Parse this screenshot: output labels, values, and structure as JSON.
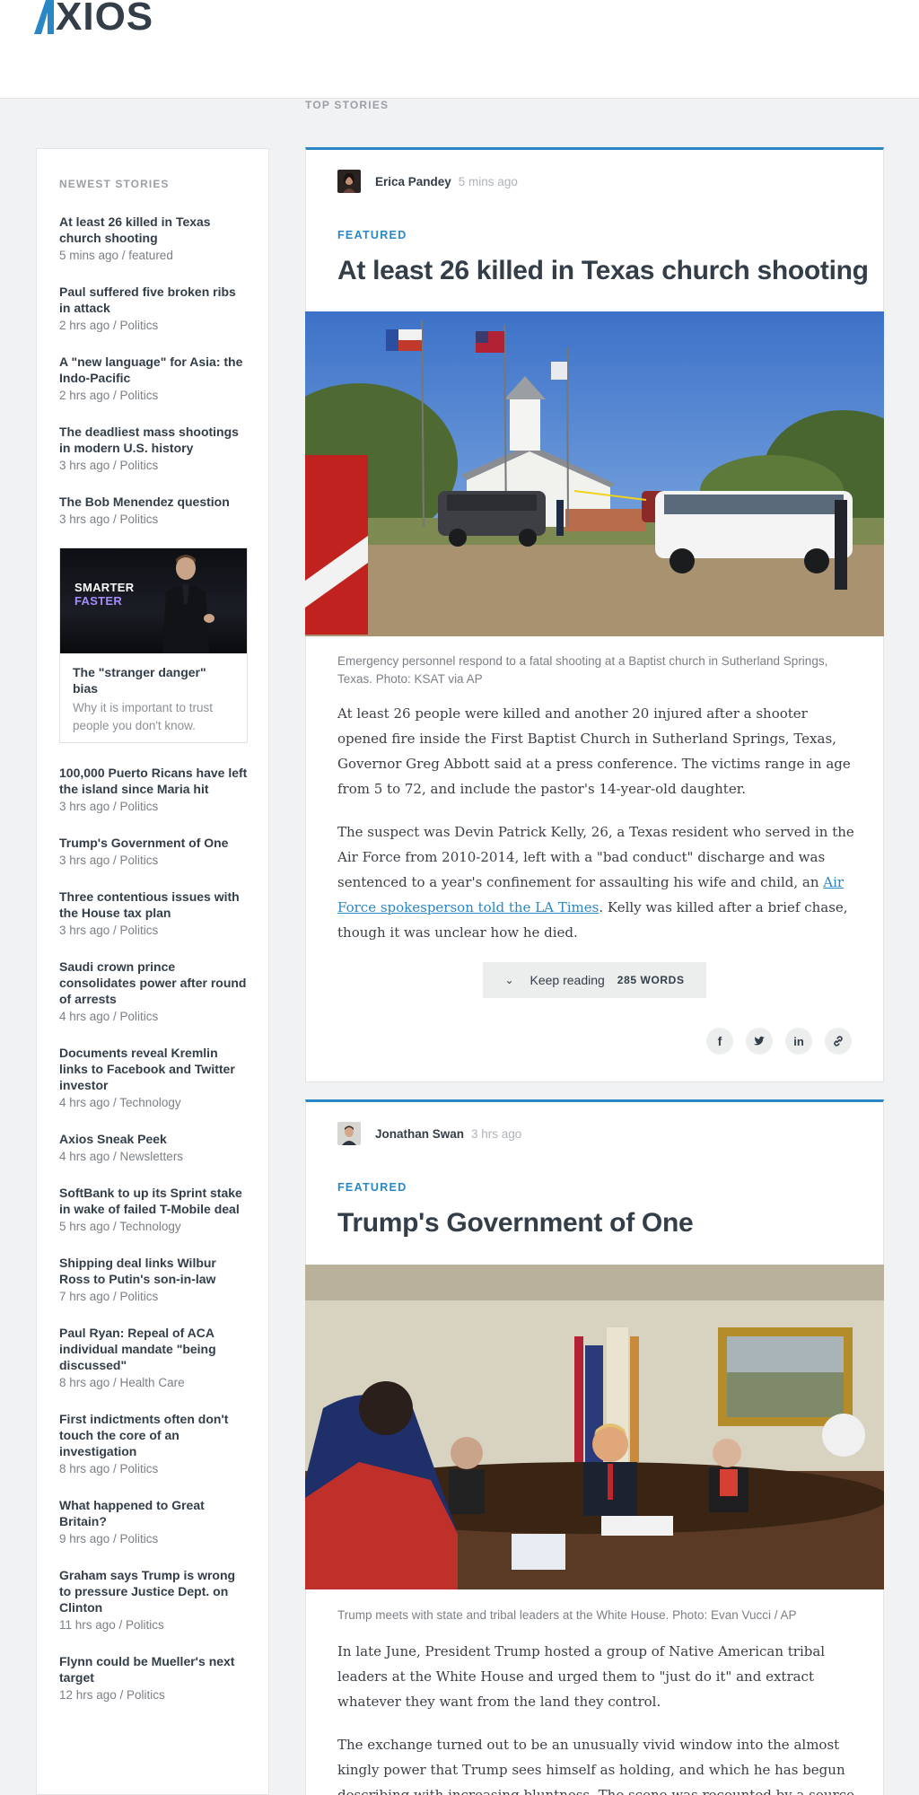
{
  "brand": {
    "logo_text": "XIOS",
    "accent": "#2a87c6"
  },
  "top_stories_label": "TOP STORIES",
  "sidebar": {
    "title": "NEWEST STORIES",
    "items_a": [
      {
        "title": "At least 26 killed in Texas church shooting",
        "meta": "5 mins ago / featured"
      },
      {
        "title": "Paul suffered five broken ribs in attack",
        "meta": "2 hrs ago / Politics"
      },
      {
        "title": "A \"new language\" for Asia: the Indo-Pacific",
        "meta": "2 hrs ago / Politics"
      },
      {
        "title": "The deadliest mass shootings in modern U.S. history",
        "meta": "3 hrs ago / Politics"
      },
      {
        "title": "The Bob Menendez question",
        "meta": "3 hrs ago / Politics"
      }
    ],
    "promo": {
      "heading1": "SMARTER",
      "heading2": "FASTER",
      "title": "The \"stranger danger\" bias",
      "desc": "Why it is important to trust people you don't know."
    },
    "items_b": [
      {
        "title": "100,000 Puerto Ricans have left the island since Maria hit",
        "meta": "3 hrs ago / Politics"
      },
      {
        "title": "Trump's Government of One",
        "meta": "3 hrs ago / Politics"
      },
      {
        "title": "Three contentious issues with the House tax plan",
        "meta": "3 hrs ago / Politics"
      },
      {
        "title": "Saudi crown prince consolidates power after round of arrests",
        "meta": "4 hrs ago / Politics"
      },
      {
        "title": "Documents reveal Kremlin links to Facebook and Twitter investor",
        "meta": "4 hrs ago / Technology"
      },
      {
        "title": "Axios Sneak Peek",
        "meta": "4 hrs ago / Newsletters"
      },
      {
        "title": "SoftBank to up its Sprint stake in wake of failed T-Mobile deal",
        "meta": "5 hrs ago / Technology"
      },
      {
        "title": "Shipping deal links Wilbur Ross to Putin's son-in-law",
        "meta": "7 hrs ago / Politics"
      },
      {
        "title": "Paul Ryan: Repeal of ACA individual mandate \"being discussed\"",
        "meta": "8 hrs ago / Health Care"
      },
      {
        "title": "First indictments often don't touch the core of an investigation",
        "meta": "8 hrs ago / Politics"
      },
      {
        "title": "What happened to Great Britain?",
        "meta": "9 hrs ago / Politics"
      },
      {
        "title": "Graham says Trump is wrong to pressure Justice Dept. on Clinton",
        "meta": "11 hrs ago / Politics"
      },
      {
        "title": "Flynn could be Mueller's next target",
        "meta": "12 hrs ago / Politics"
      }
    ]
  },
  "articles": [
    {
      "author": "Erica Pandey",
      "time": "5 mins ago",
      "kicker": "FEATURED",
      "headline": "At least 26 killed in Texas church shooting",
      "caption": "Emergency personnel respond to a fatal shooting at a Baptist church in Sutherland Springs, Texas. Photo: KSAT via AP",
      "para1": "At least 26 people were killed and another 20 injured after a shooter opened fire inside the First Baptist Church in Sutherland Springs, Texas, Governor Greg Abbott said at a press conference. The victims range in age from 5 to 72, and include the pastor's 14-year-old daughter.",
      "para2_a": "The suspect was Devin Patrick Kelly, 26, a Texas resident who served in the Air Force from 2010-2014, left with a \"bad conduct\" discharge and was sentenced to a year's confinement for assaulting his wife and child, an ",
      "para2_link": "Air Force spokesperson told the LA Times",
      "para2_b": ". Kelly was killed after a brief chase, though it was unclear how he died.",
      "keep_reading": "Keep reading",
      "word_count": "285 WORDS"
    },
    {
      "author": "Jonathan Swan",
      "time": "3 hrs ago",
      "kicker": "FEATURED",
      "headline": "Trump's Government of One",
      "caption": "Trump meets with state and tribal leaders at the White House. Photo: Evan Vucci / AP",
      "para1": "In late June, President Trump hosted a group of Native American tribal leaders at the White House and urged them to \"just do it\" and extract whatever they want from the land they control.",
      "para2": "The exchange turned out to be an unusually vivid window into the almost kingly power that Trump sees himself as holding, and which he has begun describing with increasing bluntness. The scene was recounted by a source in"
    }
  ],
  "share_icons": [
    "facebook-icon",
    "twitter-icon",
    "linkedin-icon",
    "link-icon"
  ]
}
